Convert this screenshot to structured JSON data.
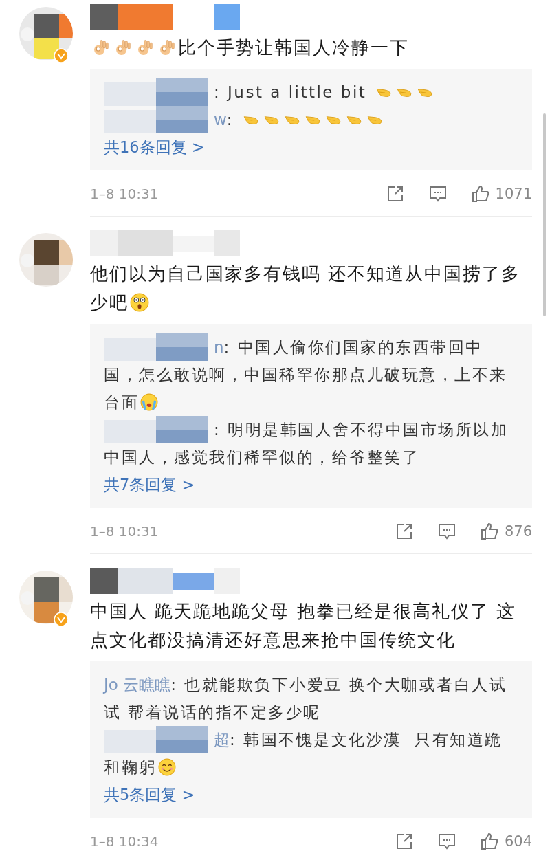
{
  "comments": [
    {
      "verified": true,
      "segments": [
        {
          "kind": "ok-hand"
        },
        {
          "kind": "ok-hand"
        },
        {
          "kind": "ok-hand"
        },
        {
          "kind": "ok-hand"
        },
        {
          "kind": "text",
          "text": "比个手势让韩国人冷静一下"
        }
      ],
      "replies": [
        {
          "pixelated": true,
          "segments": [
            {
              "kind": "text",
              "text": ": Just a little bit "
            },
            {
              "kind": "pinch"
            },
            {
              "kind": "pinch"
            },
            {
              "kind": "pinch"
            }
          ]
        },
        {
          "pixelated": true,
          "name_tail": "w",
          "segments": [
            {
              "kind": "text",
              "text": ": "
            },
            {
              "kind": "pinch"
            },
            {
              "kind": "pinch"
            },
            {
              "kind": "pinch"
            },
            {
              "kind": "pinch"
            },
            {
              "kind": "pinch"
            },
            {
              "kind": "pinch"
            },
            {
              "kind": "pinch"
            }
          ]
        }
      ],
      "more": "共16条回复 >",
      "time": "1–8 10:31",
      "likes": "1071"
    },
    {
      "verified": false,
      "segments": [
        {
          "kind": "text",
          "text": "他们以为自己国家多有钱吗 还不知道从中国捞了多少吧"
        },
        {
          "kind": "shocked"
        }
      ],
      "replies": [
        {
          "pixelated": true,
          "name_tail": "n",
          "segments": [
            {
              "kind": "text",
              "text": ": 中国人偷你们国家的东西带回中国，怎么敢说啊，中国稀罕你那点儿破玩意，上不来台面"
            },
            {
              "kind": "crying"
            }
          ]
        },
        {
          "pixelated": true,
          "segments": [
            {
              "kind": "text",
              "text": ": 明明是韩国人舍不得中国市场所以加中国人，感觉我们稀罕似的，给爷整笑了"
            }
          ]
        }
      ],
      "more": "共7条回复 >",
      "time": "1–8 10:31",
      "likes": "876"
    },
    {
      "verified": true,
      "segments": [
        {
          "kind": "text",
          "text": "中国人 跪天跪地跪父母 抱拳已经是很高礼仪了 这点文化都没搞清还好意思来抢中国传统文化"
        }
      ],
      "replies": [
        {
          "pixelated": false,
          "name_tail": "Jo 云瞧瞧",
          "segments": [
            {
              "kind": "text",
              "text": ": 也就能欺负下小爱豆 换个大咖或者白人试试 帮着说话的指不定多少呢"
            }
          ]
        },
        {
          "pixelated": true,
          "name_tail": "超",
          "segments": [
            {
              "kind": "text",
              "text": ": 韩国不愧是文化沙漠  只有知道跪和鞠躬"
            },
            {
              "kind": "smile"
            }
          ]
        }
      ],
      "more": "共5条回复 >",
      "time": "1–8 10:34",
      "likes": "604"
    }
  ]
}
